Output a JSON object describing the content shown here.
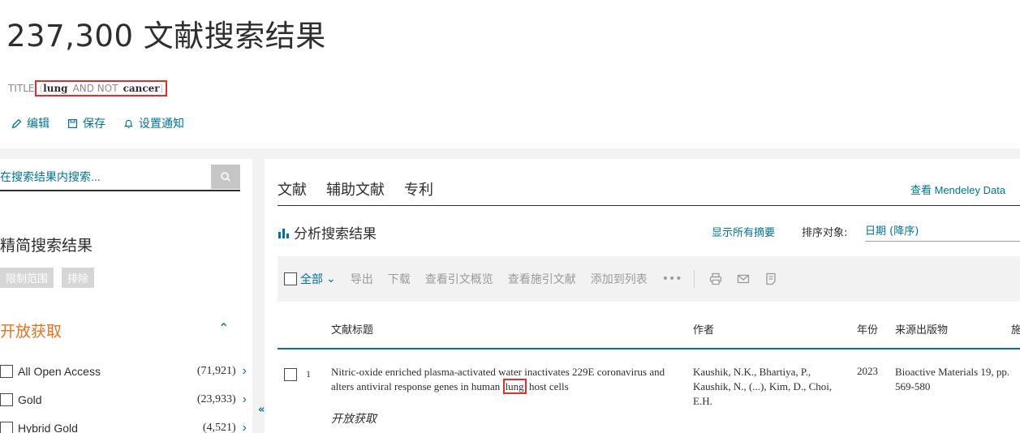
{
  "header": {
    "title": "237,300 文献搜索结果",
    "query_prefix": "TITLE",
    "query_paren_open": "(",
    "query_term1": "lung",
    "query_op": "AND NOT",
    "query_term2": "cancer",
    "query_paren_close": ")",
    "actions": {
      "edit": "编辑",
      "save": "保存",
      "alert": "设置通知"
    }
  },
  "sidebar": {
    "search_placeholder": "在搜索结果内搜索...",
    "refine_title": "精简搜索结果",
    "limit_label": "限制范围",
    "exclude_label": "排除",
    "open_access_title": "开放获取",
    "open_access_items": [
      {
        "label": "All Open Access",
        "count": "(71,921)"
      },
      {
        "label": "Gold",
        "count": "(23,933)"
      },
      {
        "label": "Hybrid Gold",
        "count": "(4,521)"
      }
    ]
  },
  "main": {
    "tabs": [
      "文献",
      "辅助文献",
      "专利"
    ],
    "mendeley_link": "查看 Mendeley Data",
    "analyze_label": "分析搜索结果",
    "show_abstracts": "显示所有摘要",
    "sort_label": "排序对象:",
    "sort_value": "日期 (降序)",
    "toolbar": {
      "select_all": "全部",
      "export": "导出",
      "download": "下载",
      "citation_overview": "查看引文概览",
      "cited_by": "查看施引文献",
      "add_to_list": "添加到列表",
      "more": "•••"
    },
    "columns": {
      "title": "文献标题",
      "authors": "作者",
      "year": "年份",
      "source": "来源出版物",
      "cited_partial": "施"
    },
    "results": [
      {
        "num": "1",
        "title_before": "Nitric-oxide enriched plasma-activated water inactivates 229E coronavirus and alters antiviral response genes in human",
        "title_highlight": "lung",
        "title_after": "host cells",
        "open_access": "开放获取",
        "authors": "Kaushik, N.K., Bhartiya, P., Kaushik, N., (...), Kim, D., Choi, E.H.",
        "year": "2023",
        "source": "Bioactive Materials 19, pp. 569-580"
      }
    ]
  },
  "colors": {
    "link": "#007398",
    "open_access": "#e9711c",
    "highlight_border": "#e0302e"
  }
}
